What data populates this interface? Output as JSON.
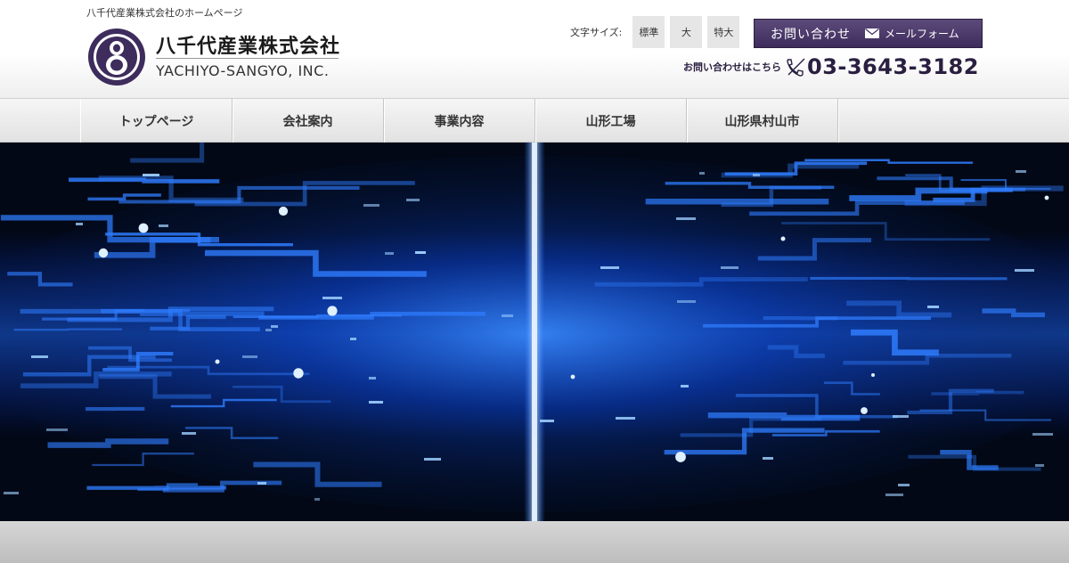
{
  "header": {
    "tagline": "八千代産業株式会社のホームページ",
    "logo": {
      "name_jp": "八千代産業株式会社",
      "name_en": "YACHIYO-SANGYO, INC.",
      "mark_color": "#3d2c5c"
    },
    "font_size": {
      "label": "文字サイズ:",
      "options": [
        "標準",
        "大",
        "特大"
      ]
    },
    "contact": {
      "main_label": "お問い合わせ",
      "form_label": "メールフォーム",
      "icon": "mail-icon",
      "color": "#3d2c5c"
    },
    "phone": {
      "caption": "お問い合わせはこちら",
      "icon": "phone-icon",
      "number": "03-3643-3182"
    }
  },
  "nav": {
    "items": [
      "トップページ",
      "会社案内",
      "事業内容",
      "山形工場",
      "山形県村山市"
    ]
  },
  "hero": {
    "image": "blue-circuit-light-banner",
    "accent": "#1a6cff"
  }
}
